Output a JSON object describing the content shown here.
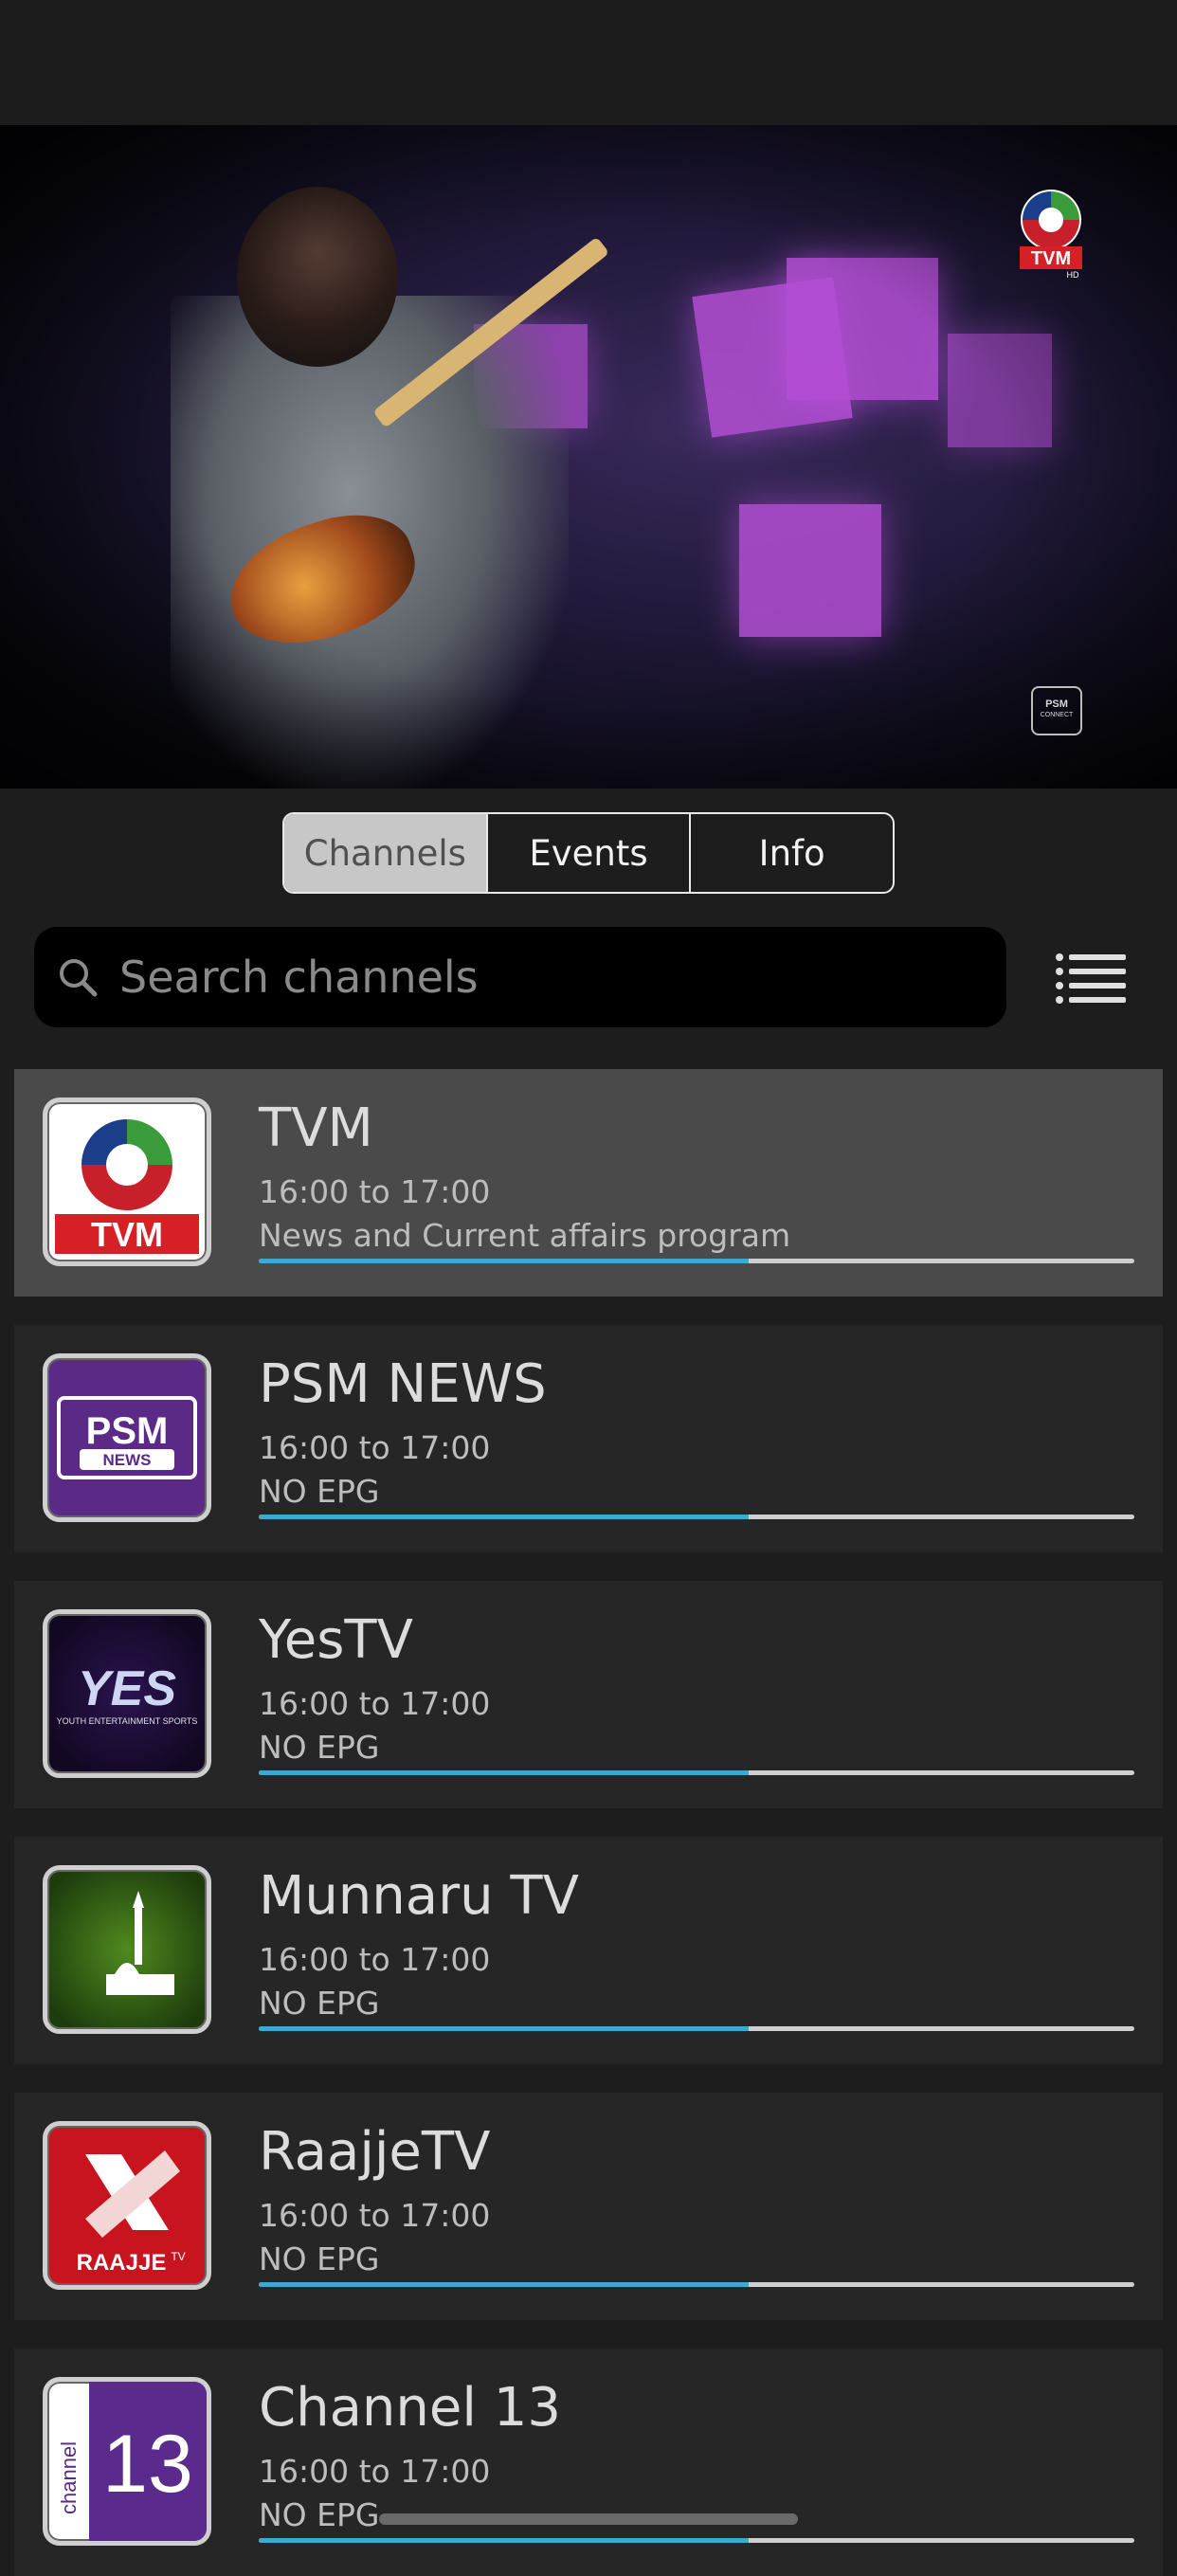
{
  "player": {
    "overlay_brand": "TVM",
    "overlay_brand_sub": "HD",
    "overlay_corner": "PSM",
    "overlay_corner_sub": "CONNECT"
  },
  "tabs": [
    "Channels",
    "Events",
    "Info"
  ],
  "selected_tab": "Channels",
  "search": {
    "placeholder": "Search channels",
    "value": ""
  },
  "colors": {
    "progress_accent": "#3ea8cf",
    "active_row": "#4a4a4a",
    "row": "#262626"
  },
  "channels": [
    {
      "name": "TVM",
      "time": "16:00 to 17:00",
      "program": "News and Current affairs program",
      "progress": 0.56,
      "active": true,
      "logo": "tvm-logo",
      "logo_text": "TVM"
    },
    {
      "name": "PSM NEWS",
      "time": "16:00 to 17:00",
      "program": "NO EPG",
      "progress": 0.56,
      "active": false,
      "logo": "psm-news-logo",
      "logo_text": "PSM",
      "logo_sub": "NEWS"
    },
    {
      "name": "YesTV",
      "time": "16:00 to 17:00",
      "program": "NO EPG",
      "progress": 0.56,
      "active": false,
      "logo": "yestv-logo",
      "logo_text": "YES",
      "logo_sub": "YOUTH ENTERTAINMENT SPORTS"
    },
    {
      "name": "Munnaru TV",
      "time": "16:00 to 17:00",
      "program": "NO EPG",
      "progress": 0.56,
      "active": false,
      "logo": "munnaru-logo"
    },
    {
      "name": "RaajjeTV",
      "time": "16:00 to 17:00",
      "program": "NO EPG",
      "progress": 0.56,
      "active": false,
      "logo": "raajje-logo",
      "logo_text": "RAAJJE",
      "logo_sub": "TV"
    },
    {
      "name": "Channel 13",
      "time": "16:00 to 17:00",
      "program": "NO EPG",
      "progress": 0.56,
      "active": false,
      "logo": "channel13-logo",
      "logo_text": "13",
      "logo_sub": "channel"
    }
  ]
}
